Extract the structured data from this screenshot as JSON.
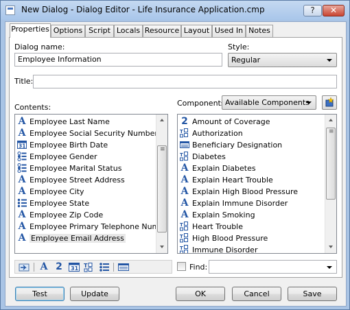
{
  "window": {
    "title": "New Dialog - Dialog Editor - Life Insurance Application.cmp",
    "help_label": "?",
    "close_label": "✕"
  },
  "tabs": [
    {
      "label": "Properties",
      "active": true
    },
    {
      "label": "Options"
    },
    {
      "label": "Script"
    },
    {
      "label": "Locals"
    },
    {
      "label": "Resource"
    },
    {
      "label": "Layout"
    },
    {
      "label": "Used In"
    },
    {
      "label": "Notes"
    }
  ],
  "form": {
    "dialog_name_label": "Dialog name:",
    "dialog_name_value": "Employee Information",
    "style_label": "Style:",
    "style_value": "Regular",
    "title_label": "Title:",
    "title_value": "",
    "contents_label": "Contents:",
    "components_label": "Components:",
    "components_value": "Available Components",
    "find_label": "Find:",
    "find_value": ""
  },
  "contents": [
    {
      "label": "Employee Last Name",
      "icon": "text-field-icon"
    },
    {
      "label": "Employee Social Security Number",
      "icon": "text-field-icon"
    },
    {
      "label": "Employee Birth Date",
      "icon": "date-field-icon"
    },
    {
      "label": "Employee Gender",
      "icon": "radio-list-icon"
    },
    {
      "label": "Employee Marital Status",
      "icon": "radio-list-icon"
    },
    {
      "label": "Employee Street Address",
      "icon": "text-field-icon"
    },
    {
      "label": "Employee City",
      "icon": "text-field-icon"
    },
    {
      "label": "Employee State",
      "icon": "bullet-list-icon"
    },
    {
      "label": "Employee Zip Code",
      "icon": "text-field-icon"
    },
    {
      "label": "Employee Primary Telephone Number",
      "icon": "text-field-icon"
    },
    {
      "label": "Employee Email Address",
      "icon": "text-field-icon",
      "selected": true
    }
  ],
  "components": [
    {
      "label": "Amount of Coverage",
      "icon": "number-field-icon"
    },
    {
      "label": "Authorization",
      "icon": "checkbox-group-icon"
    },
    {
      "label": "Beneficiary Designation",
      "icon": "table-icon"
    },
    {
      "label": "Diabetes",
      "icon": "checkbox-group-icon"
    },
    {
      "label": "Explain Diabetes",
      "icon": "text-field-icon"
    },
    {
      "label": "Explain Heart Trouble",
      "icon": "text-field-icon"
    },
    {
      "label": "Explain High Blood Pressure",
      "icon": "text-field-icon"
    },
    {
      "label": "Explain Immune Disorder",
      "icon": "text-field-icon"
    },
    {
      "label": "Explain Smoking",
      "icon": "text-field-icon"
    },
    {
      "label": "Heart Trouble",
      "icon": "checkbox-group-icon"
    },
    {
      "label": "High Blood Pressure",
      "icon": "checkbox-group-icon"
    },
    {
      "label": "Immune Disorder",
      "icon": "checkbox-group-icon"
    }
  ],
  "toolbar_icons": [
    "insert-icon",
    "text-field-icon",
    "number-field-icon",
    "date-field-icon",
    "checkbox-group-icon",
    "bullet-list-icon",
    "table-icon"
  ],
  "buttons": {
    "test": "Test",
    "update": "Update",
    "ok": "OK",
    "cancel": "Cancel",
    "save": "Save"
  },
  "colors": {
    "accent_blue": "#2255a4",
    "title_bar": "#a9c6ea",
    "close_red": "#c94532"
  }
}
